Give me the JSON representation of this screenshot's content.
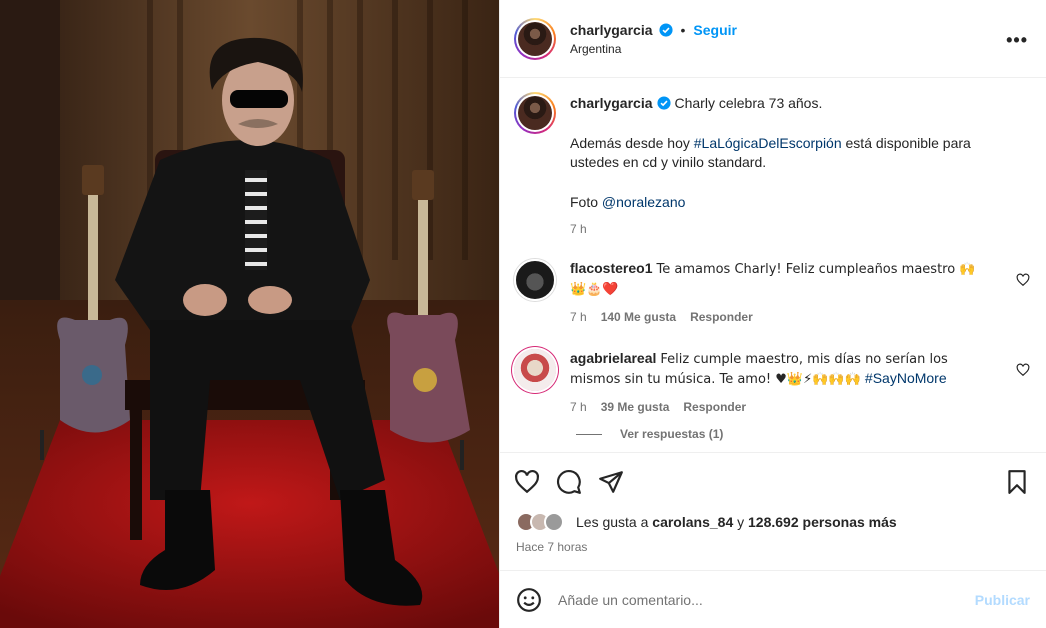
{
  "post": {
    "username": "charlygarcia",
    "follow_label": "Seguir",
    "separator": "•",
    "location": "Argentina",
    "more_label": "•••"
  },
  "caption": {
    "username": "charlygarcia",
    "line1": "Charly celebra 73 años.",
    "line2_pre": "Además desde hoy ",
    "line2_tag": "#LaLógicaDelEscorpión",
    "line2_post": " está disponible para ustedes en cd y vinilo standard.",
    "line3_pre": "Foto ",
    "line3_tag": "@noralezano",
    "time": "7 h"
  },
  "comments": [
    {
      "username": "flacostereo1",
      "text": "Te amamos Charly! Feliz cumpleaños maestro 🙌",
      "emojis": "👑🎂❤️",
      "time": "7 h",
      "likes": "140 Me gusta",
      "reply": "Responder"
    },
    {
      "username": "agabrielareal",
      "text": "Feliz cumple maestro, mis días no serían los mismos sin tu música. Te amo! ♥👑⚡🙌🙌🙌 ",
      "tag": "#SayNoMore",
      "time": "7 h",
      "likes": "39 Me gusta",
      "reply": "Responder"
    }
  ],
  "view_replies": "Ver respuestas (1)",
  "likes": {
    "prefix": "Les gusta a ",
    "user": "carolans_84",
    "mid": " y ",
    "count": "128.692 personas más"
  },
  "posted_time": "Hace 7 horas",
  "comment_box": {
    "placeholder": "Añade un comentario...",
    "publish_label": "Publicar"
  },
  "colors": {
    "accent": "#0095f6",
    "publish_disabled": "#b3dbff",
    "hashtag": "#00376b",
    "secondary_text": "#737373"
  }
}
